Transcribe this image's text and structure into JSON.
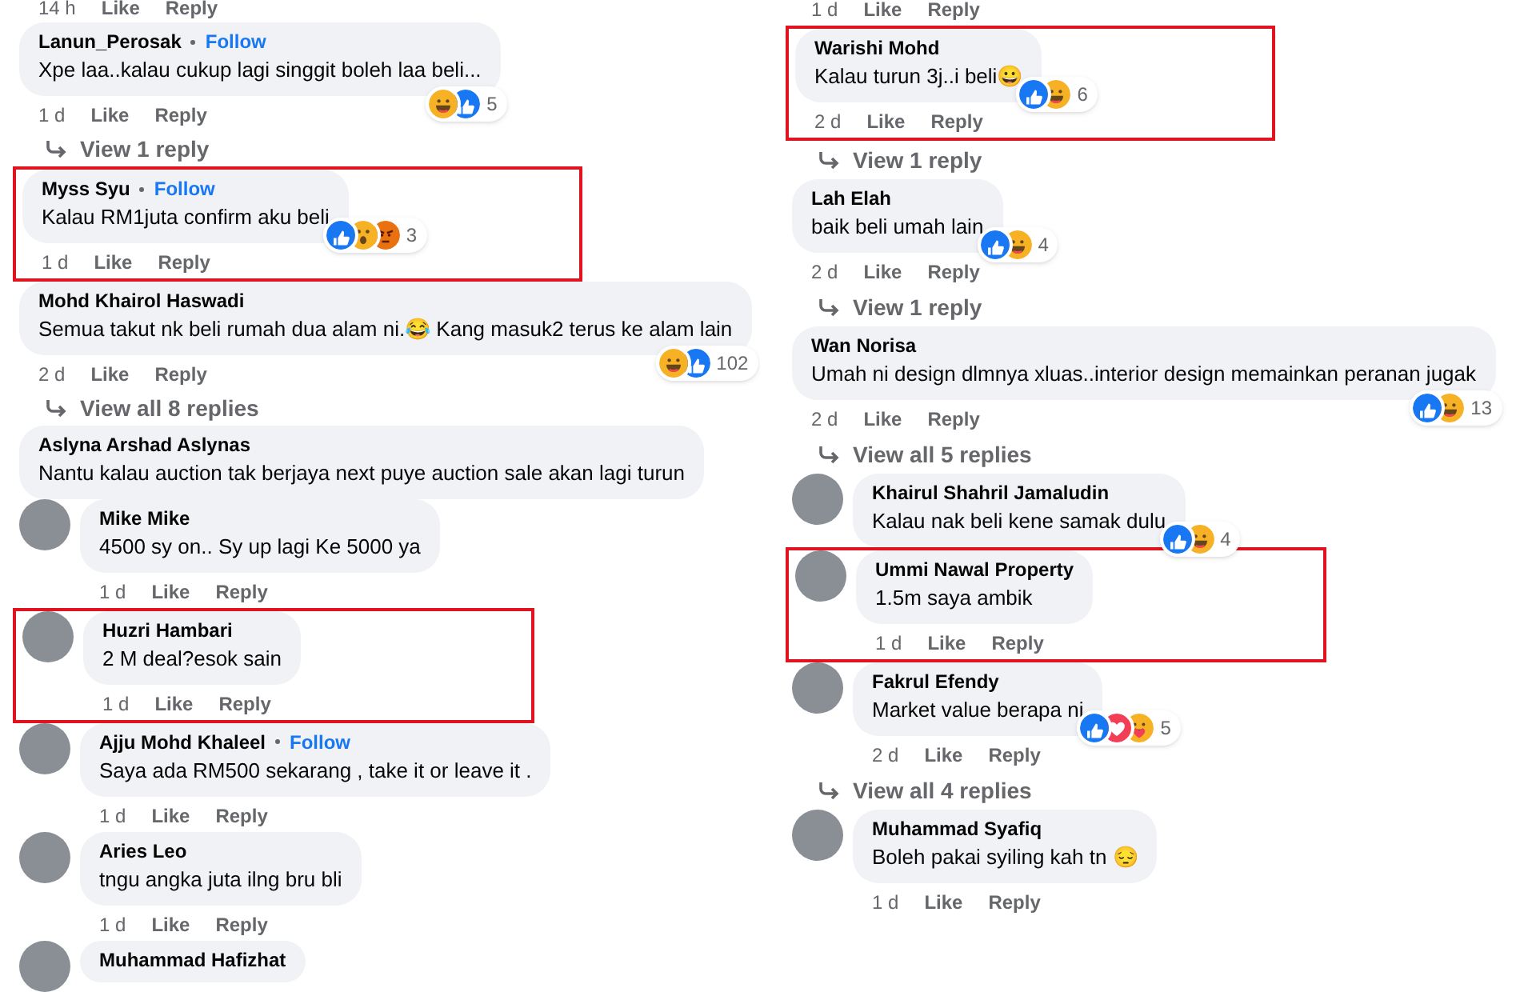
{
  "columns": [
    {
      "items": [
        {
          "kind": "actions",
          "time": "14 h",
          "like": "Like",
          "reply": "Reply"
        },
        {
          "kind": "comment",
          "name": "Lanun_Perosak",
          "follow": "Follow",
          "text": "Xpe laa..kalau cukup lagi singgit boleh laa beli...",
          "reactions": [
            {
              "kind": "haha"
            },
            {
              "kind": "like"
            }
          ],
          "count": "5",
          "time": "1 d",
          "like": "Like",
          "reply": "Reply",
          "avatar": false,
          "highlighted": false
        },
        {
          "kind": "replies",
          "label": "View 1 reply"
        },
        {
          "kind": "comment",
          "name": "Myss Syu",
          "follow": "Follow",
          "text": "Kalau RM1juta confirm aku beli",
          "reactions": [
            {
              "kind": "like"
            },
            {
              "kind": "wow"
            },
            {
              "kind": "angry"
            }
          ],
          "count": "3",
          "time": "1 d",
          "like": "Like",
          "reply": "Reply",
          "avatar": false,
          "highlighted": true
        },
        {
          "kind": "comment",
          "name": "Mohd Khairol Haswadi",
          "text": "Semua takut nk beli rumah dua alam ni.😂 Kang masuk2 terus ke alam lain",
          "reactions": [
            {
              "kind": "haha"
            },
            {
              "kind": "like"
            }
          ],
          "count": "102",
          "time": "2 d",
          "like": "Like",
          "reply": "Reply",
          "avatar": false,
          "highlighted": false
        },
        {
          "kind": "replies",
          "label": "View all 8 replies"
        },
        {
          "kind": "comment",
          "name": "Aslyna Arshad Aslynas",
          "text": "Nantu kalau auction tak berjaya next puye auction sale akan lagi turun",
          "avatar": false,
          "highlighted": false
        },
        {
          "kind": "comment",
          "name": "Mike Mike",
          "text": "4500 sy on.. Sy up lagi Ke 5000 ya",
          "time": "1 d",
          "like": "Like",
          "reply": "Reply",
          "avatar": true,
          "highlighted": false
        },
        {
          "kind": "comment",
          "name": "Huzri Hambari",
          "text": "2 M deal?esok sain",
          "time": "1 d",
          "like": "Like",
          "reply": "Reply",
          "avatar": true,
          "highlighted": true
        },
        {
          "kind": "comment",
          "name": "Ajju Mohd Khaleel",
          "follow": "Follow",
          "text": "Saya ada RM500 sekarang , take it or leave it .",
          "time": "1 d",
          "like": "Like",
          "reply": "Reply",
          "avatar": true,
          "highlighted": false
        },
        {
          "kind": "comment",
          "name": "Aries Leo",
          "text": "tngu angka juta ilng bru bli",
          "time": "1 d",
          "like": "Like",
          "reply": "Reply",
          "avatar": true,
          "highlighted": false
        },
        {
          "kind": "comment",
          "name": "Muhammad Hafizhat",
          "avatar": true,
          "highlighted": false
        }
      ]
    },
    {
      "items": [
        {
          "kind": "actions",
          "time": "1 d",
          "like": "Like",
          "reply": "Reply"
        },
        {
          "kind": "comment",
          "name": "Warishi Mohd",
          "text": "Kalau turun 3j..i beli😀",
          "reactions": [
            {
              "kind": "like"
            },
            {
              "kind": "haha"
            }
          ],
          "count": "6",
          "time": "2 d",
          "like": "Like",
          "reply": "Reply",
          "avatar": false,
          "highlighted": true
        },
        {
          "kind": "replies",
          "label": "View 1 reply"
        },
        {
          "kind": "comment",
          "name": "Lah Elah",
          "text": "baik beli umah lain",
          "reactions": [
            {
              "kind": "like"
            },
            {
              "kind": "haha"
            }
          ],
          "count": "4",
          "time": "2 d",
          "like": "Like",
          "reply": "Reply",
          "avatar": false,
          "highlighted": false
        },
        {
          "kind": "replies",
          "label": "View 1 reply"
        },
        {
          "kind": "comment",
          "name": "Wan Norisa",
          "text": "Umah ni design dlmnya xluas..interior design memainkan peranan jugak",
          "reactions": [
            {
              "kind": "like"
            },
            {
              "kind": "haha"
            }
          ],
          "count": "13",
          "time": "2 d",
          "like": "Like",
          "reply": "Reply",
          "avatar": false,
          "highlighted": false
        },
        {
          "kind": "replies",
          "label": "View all 5 replies"
        },
        {
          "kind": "comment",
          "name": "Khairul Shahril Jamaludin",
          "text": "Kalau nak beli kene samak dulu",
          "reactions": [
            {
              "kind": "like"
            },
            {
              "kind": "haha"
            }
          ],
          "count": "4",
          "avatar": true,
          "highlighted": false
        },
        {
          "kind": "comment",
          "name": "Ummi Nawal Property",
          "text": "1.5m saya ambik",
          "time": "1 d",
          "like": "Like",
          "reply": "Reply",
          "avatar": true,
          "highlighted": true
        },
        {
          "kind": "comment",
          "name": "Fakrul Efendy",
          "text": "Market value berapa ni",
          "reactions": [
            {
              "kind": "like"
            },
            {
              "kind": "love"
            },
            {
              "kind": "care"
            }
          ],
          "count": "5",
          "time": "2 d",
          "like": "Like",
          "reply": "Reply",
          "avatar": true,
          "highlighted": false
        },
        {
          "kind": "replies",
          "label": "View all 4 replies"
        },
        {
          "kind": "comment",
          "name": "Muhammad Syafiq",
          "text": "Boleh pakai syiling kah tn 😔",
          "time": "1 d",
          "like": "Like",
          "reply": "Reply",
          "avatar": true,
          "highlighted": false
        }
      ]
    }
  ]
}
